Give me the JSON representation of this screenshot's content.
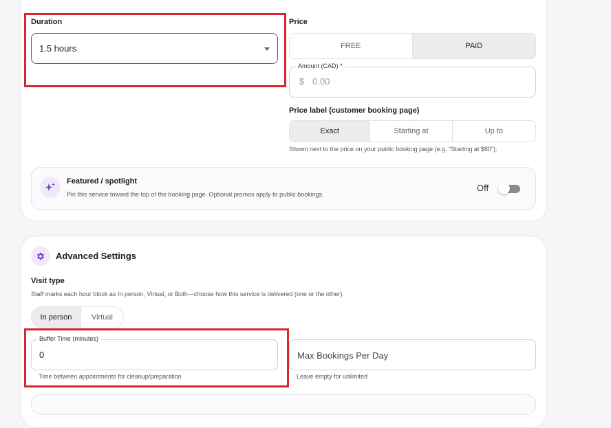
{
  "duration": {
    "label": "Duration",
    "value": "1.5 hours"
  },
  "price": {
    "label": "Price",
    "options": [
      "FREE",
      "PAID"
    ],
    "amount_label": "Amount (CAD) *",
    "currency_symbol": "$",
    "amount_placeholder": "0.00"
  },
  "price_label": {
    "label": "Price label (customer booking page)",
    "options": [
      "Exact",
      "Starting at",
      "Up to"
    ],
    "helper": "Shown next to the price on your public booking page (e.g. \"Starting at $80\")."
  },
  "featured": {
    "title": "Featured / spotlight",
    "description": "Pin this service toward the top of the booking page. Optional promos apply to public bookings.",
    "state_label": "Off",
    "icon": "sparkles-icon"
  },
  "advanced": {
    "title": "Advanced Settings",
    "icon": "gear-icon",
    "visit_type": {
      "label": "Visit type",
      "helper": "Staff marks each hour block as In person, Virtual, or Both—choose how this service is delivered (one or the other).",
      "options": [
        "In person",
        "Virtual"
      ]
    },
    "buffer": {
      "label": "Buffer Time (minutes)",
      "value": "0",
      "helper": "Time between appointments for cleanup/preparation"
    },
    "max_bookings": {
      "placeholder": "Max Bookings Per Day",
      "helper": "Leave empty for unlimited"
    }
  },
  "colors": {
    "accent": "#6a3fc6",
    "highlight": "#d9232d"
  }
}
